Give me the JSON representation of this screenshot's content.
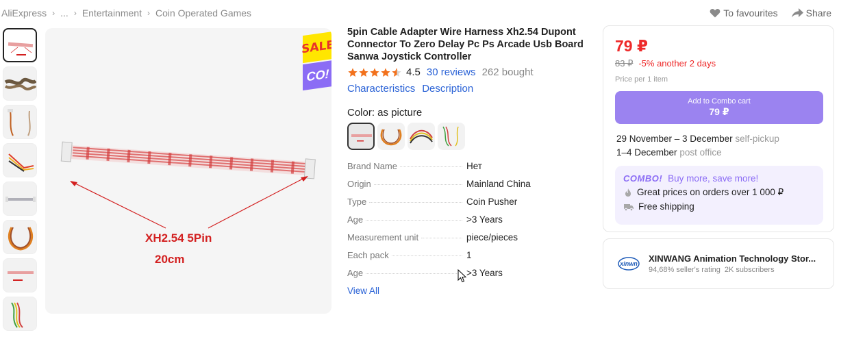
{
  "breadcrumb": {
    "items": [
      "AliExpress",
      "...",
      "Entertainment",
      "Coin Operated Games"
    ]
  },
  "actions": {
    "favourites": "To favourites",
    "share": "Share"
  },
  "gallery": {
    "thumb_count": 8,
    "sale_badge_top": "SALE",
    "sale_badge_bottom": "CO!",
    "image_label_1": "XH2.54 5Pin",
    "image_label_2": "20cm"
  },
  "product": {
    "title": "5pin Cable Adapter Wire Harness Xh2.54 Dupont Connector To Zero Delay Pc Ps Arcade Usb Board Sanwa Joystick Controller",
    "rating": "4.5",
    "reviews": "30 reviews",
    "bought": "262 bought",
    "link_characteristics": "Characteristics",
    "link_description": "Description",
    "color_label": "Color: as picture"
  },
  "specs": [
    {
      "name": "Brand Name",
      "value": "Нет"
    },
    {
      "name": "Origin",
      "value": "Mainland China"
    },
    {
      "name": "Type",
      "value": "Coin Pusher"
    },
    {
      "name": "Age",
      "value": ">3 Years"
    },
    {
      "name": "Measurement unit",
      "value": "piece/pieces"
    },
    {
      "name": "Each pack",
      "value": "1"
    },
    {
      "name": "Age",
      "value": ">3 Years"
    }
  ],
  "view_all": "View All",
  "buy": {
    "price": "79 ₽",
    "old_price": "83 ₽",
    "discount": "-5% another 2 days",
    "per_item": "Price per 1 item",
    "combo_btn_line1": "Add to Combo cart",
    "combo_btn_line2": "79 ₽",
    "delivery_1_date": "29 November – 3 December",
    "delivery_1_method": "self-pickup",
    "delivery_2_date": "1–4 December",
    "delivery_2_method": "post office",
    "combo_logo": "COMBO!",
    "combo_tagline": "Buy more, save more!",
    "combo_line_1": "Great prices on orders over 1 000 ₽",
    "combo_line_2": "Free shipping"
  },
  "store": {
    "logo_text": "xinwn",
    "name": "XINWANG Animation Technology Stor...",
    "rating": "94,68% seller's rating",
    "subscribers": "2K subscribers"
  },
  "colors": {
    "price_red": "#ee2a2a",
    "link_blue": "#2a62d6",
    "combo_purple": "#9b83f0",
    "star_orange": "#f2711c"
  }
}
